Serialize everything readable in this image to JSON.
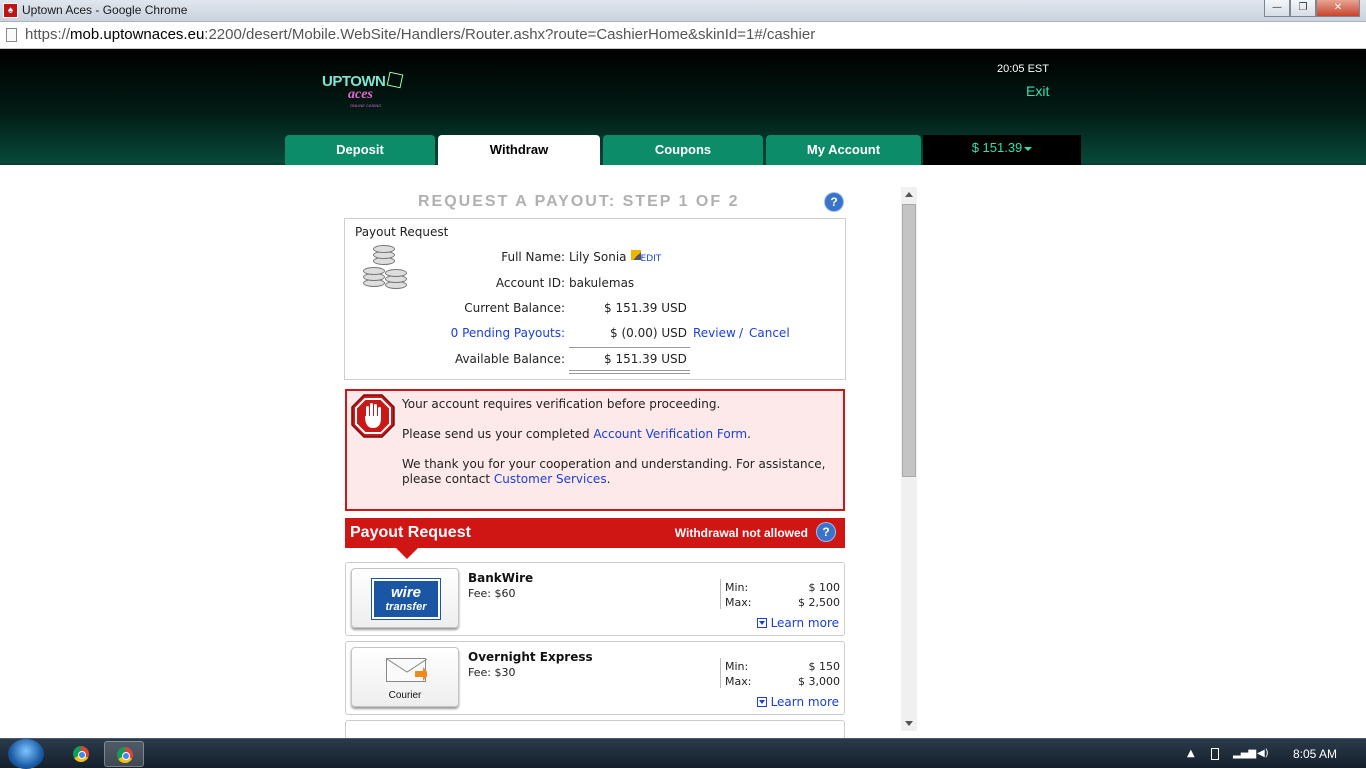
{
  "window": {
    "title": "Uptown Aces - Google Chrome",
    "minimize": "—",
    "maximize": "❐",
    "close": "✕"
  },
  "address": {
    "scheme": "https://",
    "host": "mob.uptownaces.eu",
    "rest": ":2200/desert/Mobile.WebSite/Handlers/Router.ashx?route=CashierHome&skinId=1#/cashier"
  },
  "header": {
    "logo_top": "UPTOWN",
    "logo_bottom": "aces",
    "logo_tagline": "ONLINE CASINO",
    "clock": "20:05 EST",
    "exit_label": "Exit"
  },
  "tabs": [
    {
      "label": "Deposit"
    },
    {
      "label": "Withdraw"
    },
    {
      "label": "Coupons"
    },
    {
      "label": "My Account"
    }
  ],
  "balance_tab": "$ 151.39",
  "page": {
    "heading": "REQUEST A PAYOUT: STEP 1 OF 2",
    "help": "?"
  },
  "summary": {
    "title": "Payout Request",
    "full_name_label": "Full Name:",
    "full_name": "Lily Sonia",
    "edit": "EDIT",
    "account_id_label": "Account ID:",
    "account_id": "bakulemas",
    "current_balance_label": "Current Balance:",
    "current_balance": "$ 151.39 USD",
    "pending_label": "0 Pending Payouts:",
    "pending_value": "$ (0.00) USD",
    "review": "Review",
    "separator": "/",
    "cancel": "Cancel",
    "available_label": "Available Balance:",
    "available": "$ 151.39 USD"
  },
  "alert": {
    "line1": "Your account requires verification before proceeding.",
    "line2_prefix": "Please send us your completed ",
    "line2_link": "Account Verification Form",
    "line2_suffix": ".",
    "line3": "We thank you for your cooperation and understanding. For assistance,",
    "line4_prefix": "please contact ",
    "line4_link": "Customer Services",
    "line4_suffix": "."
  },
  "payout_bar": {
    "title": "Payout Request",
    "status": "Withdrawal not allowed"
  },
  "methods": [
    {
      "name": "BankWire",
      "fee": "Fee: $60",
      "logo_line1": "wire",
      "logo_line2": "transfer",
      "min_label": "Min:",
      "min": "$ 100",
      "max_label": "Max:",
      "max": "$ 2,500",
      "learn_more": "Learn more"
    },
    {
      "name": "Overnight Express",
      "fee": "Fee: $30",
      "logo_label": "Courier",
      "min_label": "Min:",
      "min": "$ 150",
      "max_label": "Max:",
      "max": "$ 3,000",
      "learn_more": "Learn more"
    }
  ],
  "taskbar": {
    "clock": "8:05 AM"
  },
  "colors": {
    "brand_green": "#0d8c69",
    "accent_teal": "#31e0b2",
    "alert_red": "#d01515",
    "link_blue": "#1a3fd6"
  }
}
